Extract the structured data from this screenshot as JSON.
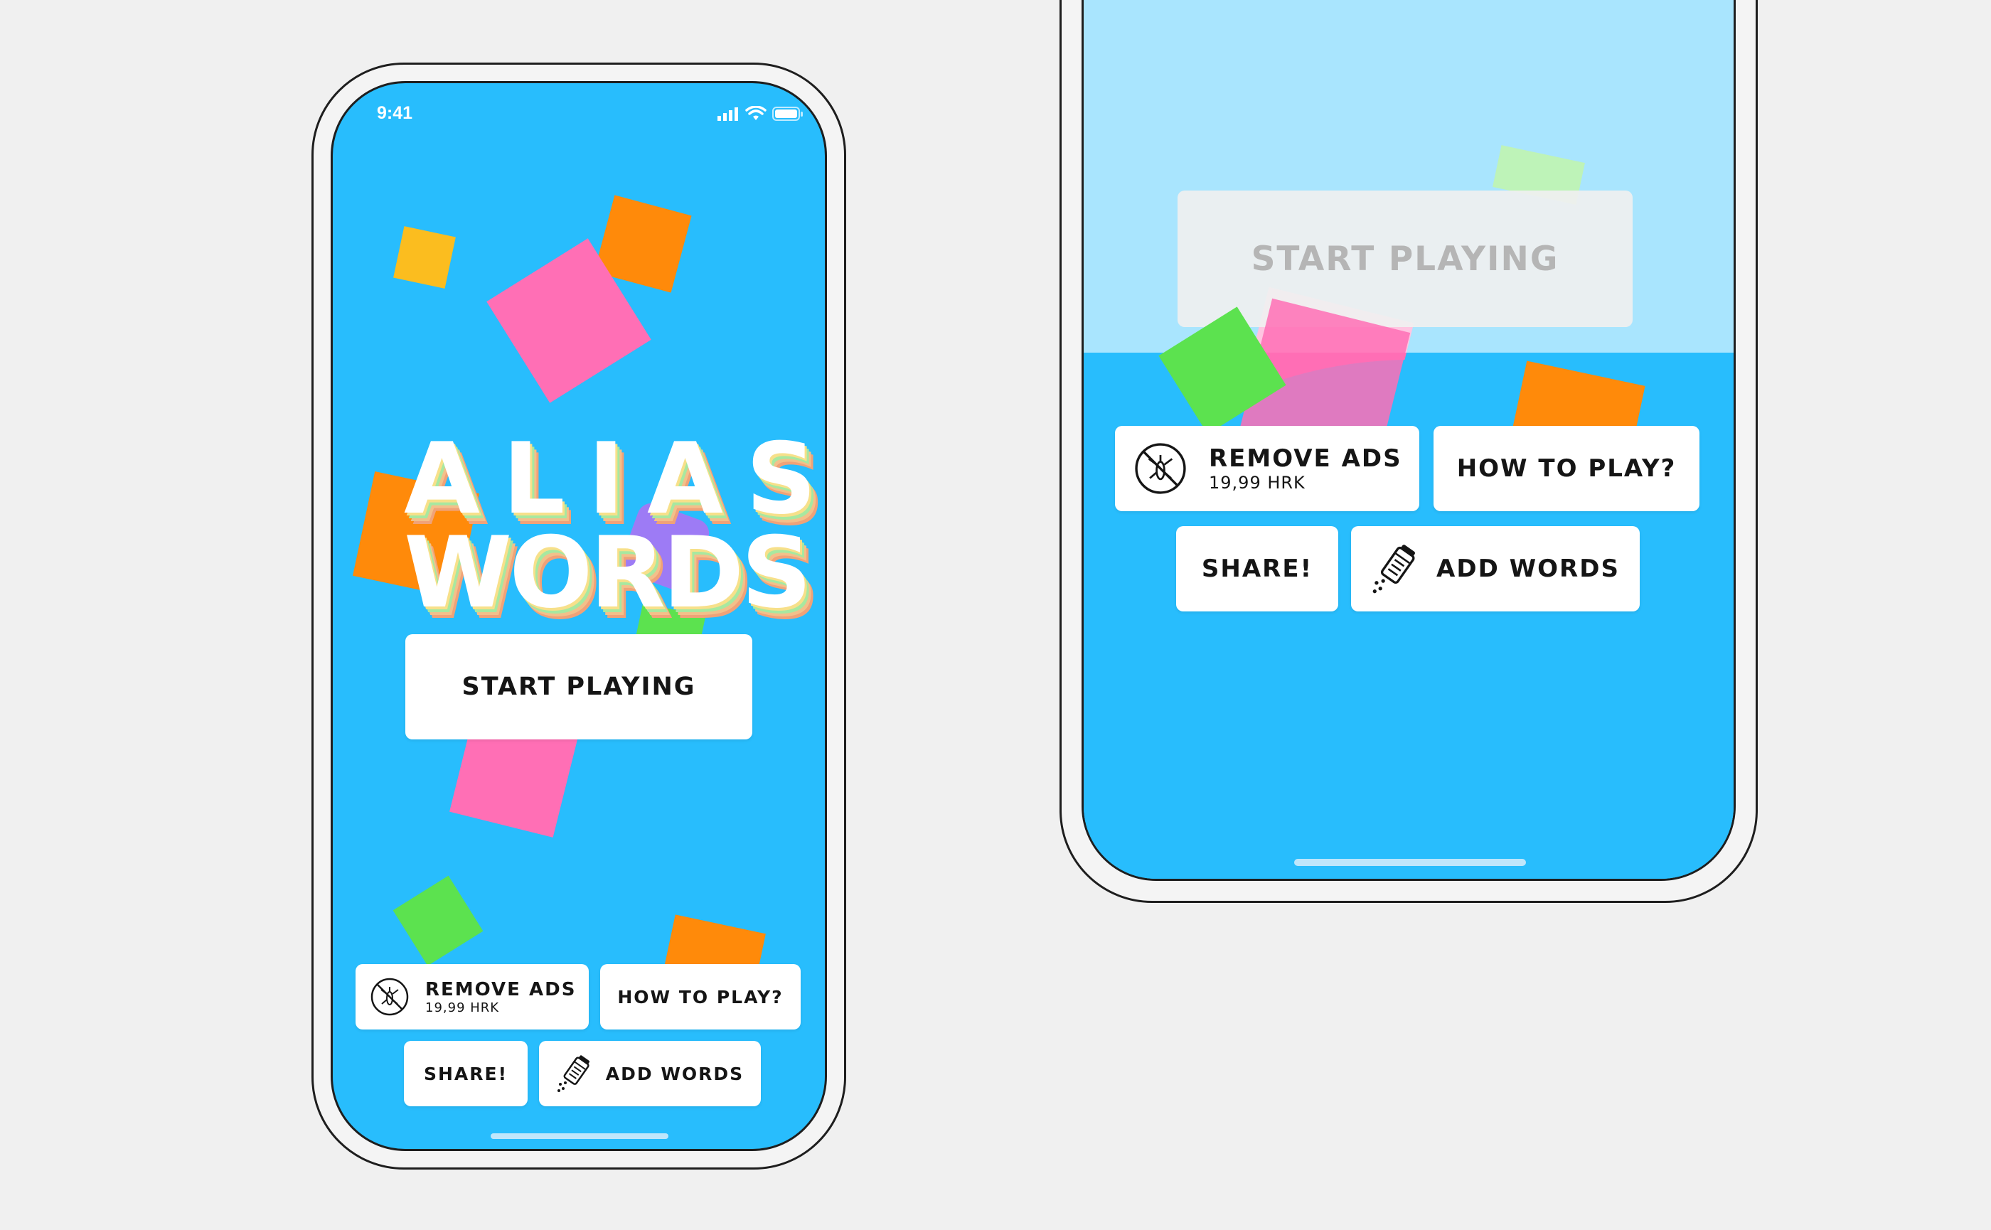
{
  "status_bar": {
    "time": "9:41"
  },
  "title": {
    "line1": "ALIAS",
    "line2": "WORDS"
  },
  "buttons": {
    "start": "START PLAYING",
    "remove_ads": "REMOVE ADS",
    "remove_ads_price": "19,99 HRK",
    "how_to_play": "HOW TO PLAY?",
    "share": "SHARE!",
    "add_words": "ADD WORDS"
  },
  "icons": {
    "remove_ads": "no-mosquito-icon",
    "add_words": "salt-shaker-icon",
    "signal": "signal-bars-icon",
    "wifi": "wifi-icon",
    "battery": "battery-icon"
  },
  "colors": {
    "background": "#28bdfd",
    "confetti": [
      "#ff8a0a",
      "#ff6fb5",
      "#5ce24f",
      "#fbbd1f",
      "#9d7bf5"
    ]
  }
}
